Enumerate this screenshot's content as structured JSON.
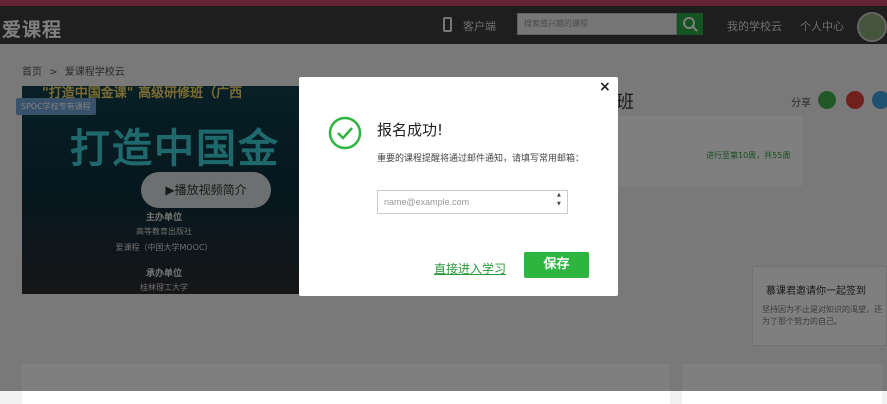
{
  "header": {
    "logo": "爱课程",
    "client_label": "客户端",
    "search_placeholder": "搜索感兴趣的课程",
    "nav_school": "我的学校云",
    "nav_personal": "个人中心"
  },
  "breadcrumb": {
    "home": "首页",
    "separator": ">",
    "current": "爱课程学校云"
  },
  "banner": {
    "title": "\"打造中国金课\" 高级研修班（广西",
    "big_text": "打造中国金",
    "spoc_tag": "SPOC学校专有课程",
    "play_label": "播放视频简介",
    "host_label": "主办单位",
    "host_1": "高等教育出版社",
    "host_2": "爱课程（中国大学MOOC）",
    "org_label": "承办单位",
    "org_1": "桂林理工大学"
  },
  "course": {
    "title_suffix": "班",
    "share_label": "分享",
    "progress_text": "进行至第10周，共55周"
  },
  "checkin": {
    "title": "慕课君邀请你一起签到",
    "desc": "坚持因为不止是对知识的渴望，还为了那个努力的自己。"
  },
  "modal": {
    "close": "×",
    "title": "报名成功!",
    "description": "重要的课程提醒将通过邮件通知，请填写常用邮箱：",
    "email_placeholder": "name@example.com",
    "direct_link": "直接进入学习",
    "save_label": "保存"
  },
  "colors": {
    "brand_green": "#2db540",
    "top_stripe": "#c9456b",
    "header_bg": "#3c3c3c"
  }
}
